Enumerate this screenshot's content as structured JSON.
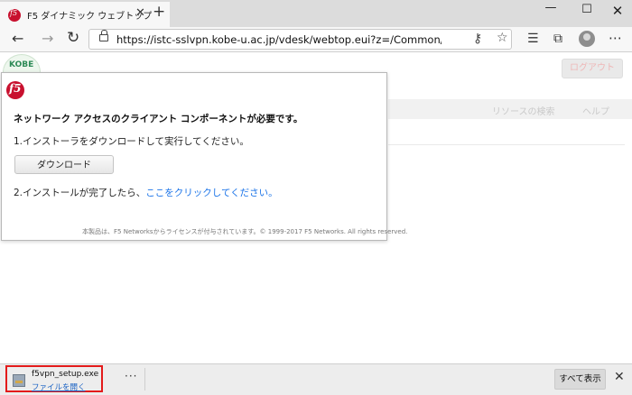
{
  "browser": {
    "tab_title": "F5 ダイナミック ウェブトップ",
    "tab_close": "✕",
    "new_tab": "+",
    "window_minimize": "—",
    "window_maximize": "☐",
    "window_close": "✕",
    "back": "←",
    "forward": "→",
    "reload": "↻",
    "url": "https://istc-sslvpn.kobe-u.ac.jp/vdesk/webtop.eui?z=/Common/kyoshoku_na_r...",
    "more": "⋯"
  },
  "page": {
    "logo_text": "KOBE",
    "logout": "ログアウト",
    "search_resources": "リソースの検索",
    "help": "ヘルプ"
  },
  "dialog": {
    "heading": "ネットワーク アクセスのクライアント コンポーネントが必要です。",
    "step1": "1.インストーラをダウンロードして実行してください。",
    "download_button": "ダウンロード",
    "step2_prefix": "2.インストールが完了したら、",
    "step2_link": "ここをクリックしてください。",
    "copyright": "本製品は、F5 Networksからライセンスが付与されています。© 1999-2017 F5 Networks. All rights reserved."
  },
  "download_bar": {
    "file_name": "f5vpn_setup.exe",
    "open_file": "ファイルを開く",
    "more": "···",
    "show_all": "すべて表示",
    "close": "✕"
  }
}
